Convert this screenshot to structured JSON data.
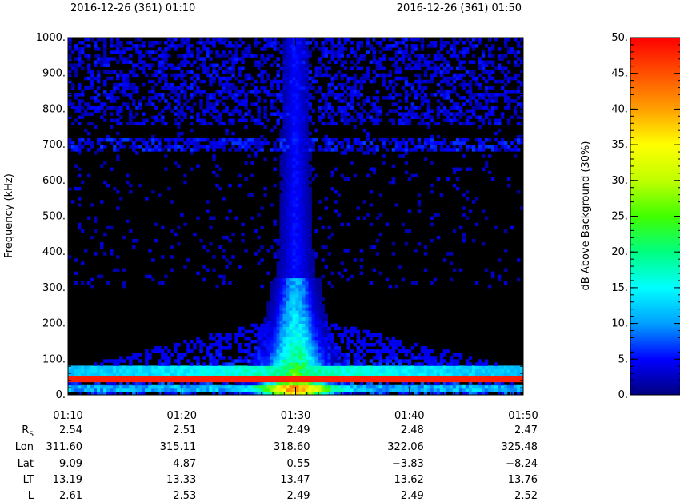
{
  "chart_data": {
    "type": "heatmap",
    "title_left": "2016-12-26 (361) 01:10",
    "title_right": "2016-12-26 (361) 01:50",
    "ylabel": "Frequency (kHz)",
    "ylim": [
      0,
      1000
    ],
    "y_ticks": [
      0,
      100,
      200,
      300,
      400,
      500,
      600,
      700,
      800,
      900,
      1000
    ],
    "y_tick_labels": [
      "0.",
      "100.",
      "200.",
      "300.",
      "400.",
      "500.",
      "600.",
      "700.",
      "800.",
      "900.",
      "1000."
    ],
    "x_tick_labels": [
      "01:10",
      "01:20",
      "01:30",
      "01:40",
      "01:50"
    ],
    "xlim_minutes": [
      0,
      40
    ],
    "colorbar": {
      "label": "dB Above Background (30%)",
      "range": [
        0,
        50
      ],
      "ticks": [
        0,
        5,
        10,
        15,
        20,
        25,
        30,
        35,
        40,
        45,
        50
      ],
      "tick_labels": [
        "0.",
        "5.",
        "10.",
        "15.",
        "20.",
        "25.",
        "30.",
        "35.",
        "40.",
        "45.",
        "50."
      ],
      "colors": [
        "#000080",
        "#0000ff",
        "#00a0ff",
        "#00ffff",
        "#00ff80",
        "#40ff00",
        "#c0ff00",
        "#ffff00",
        "#ffa000",
        "#ff5000",
        "#ff0000"
      ]
    },
    "emission_features": [
      {
        "freq_khz": 45,
        "db": 48
      },
      {
        "freq_khz": 70,
        "db": 22
      },
      {
        "freq_khz": 700,
        "db": 5
      }
    ],
    "burst_minute": 20,
    "ephemeris": {
      "labels": [
        "R_S",
        "Lon",
        "Lat",
        "LT",
        "L"
      ],
      "rows": [
        [
          "2.54",
          "2.51",
          "2.49",
          "2.48",
          "2.47"
        ],
        [
          "311.60",
          "315.11",
          "318.60",
          "322.06",
          "325.48"
        ],
        [
          "9.09",
          "4.87",
          "0.55",
          "−3.83",
          "−8.24"
        ],
        [
          "13.19",
          "13.33",
          "13.47",
          "13.62",
          "13.76"
        ],
        [
          "2.61",
          "2.53",
          "2.49",
          "2.49",
          "2.52"
        ]
      ]
    }
  }
}
